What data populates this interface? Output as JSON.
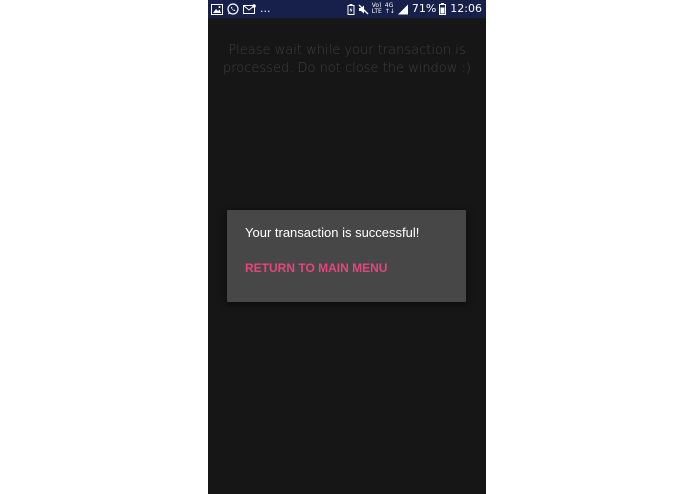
{
  "status_bar": {
    "left_icons": [
      "image-icon",
      "whatsapp-icon",
      "mail-icon"
    ],
    "more_indicator": "...",
    "network_type_top": "Vo)",
    "network_type_bottom": "LTE",
    "data_type_top": "4G",
    "battery_percent": "71%",
    "time": "12:06",
    "background_color": "#16204a"
  },
  "main": {
    "wait_message": "Please wait while your transaction is processed. Do not close the window :)",
    "background_color": "#161616"
  },
  "dialog": {
    "message": "Your transaction is successful!",
    "button_label": "RETURN TO MAIN MENU",
    "button_color": "#e5457d",
    "background_color": "#474747"
  }
}
